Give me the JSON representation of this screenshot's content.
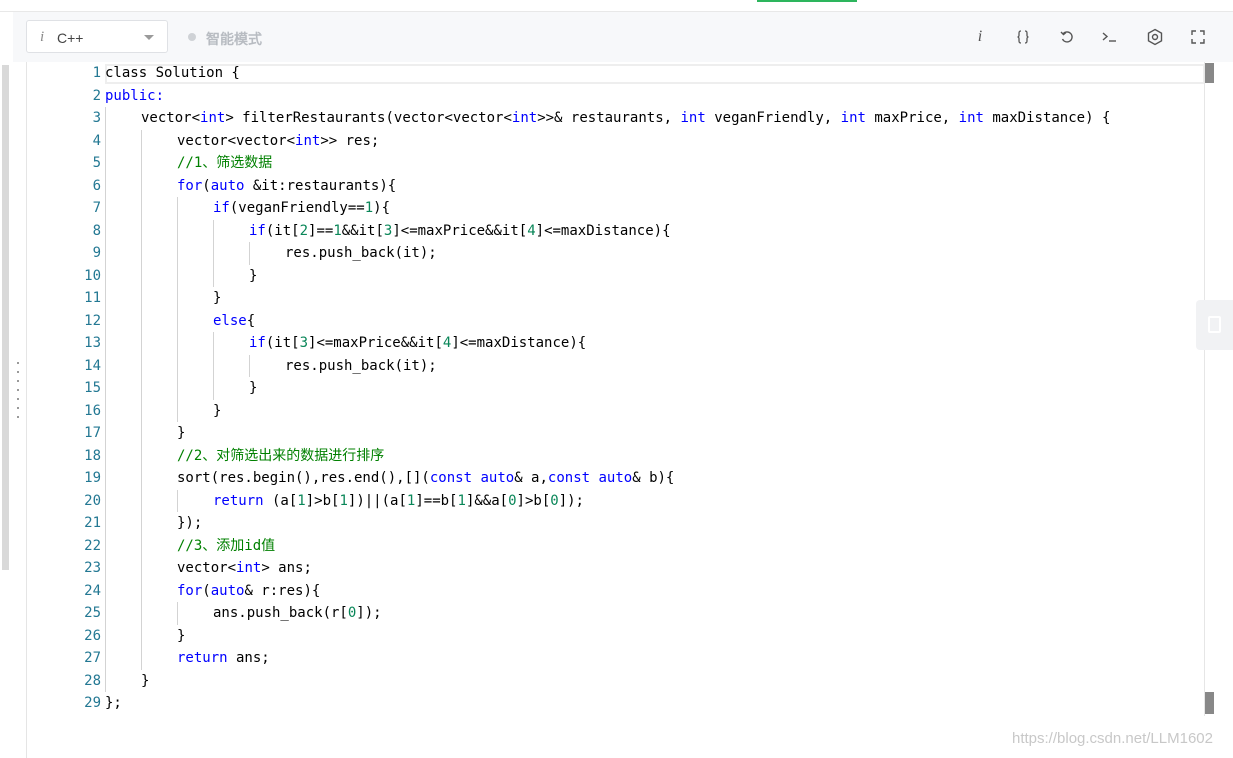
{
  "toolbar": {
    "info_glyph": "i",
    "language": "C++",
    "mode_label": "智能模式",
    "buttons": [
      {
        "name": "info-button",
        "icon": "info-icon"
      },
      {
        "name": "format-button",
        "icon": "braces-icon"
      },
      {
        "name": "reset-button",
        "icon": "undo-icon"
      },
      {
        "name": "console-button",
        "icon": "terminal-icon"
      },
      {
        "name": "settings-button",
        "icon": "settings-icon"
      },
      {
        "name": "fullscreen-button",
        "icon": "fullscreen-icon"
      }
    ]
  },
  "editor": {
    "line_number_color": "#237893",
    "keyword_color": "#0000ff",
    "number_color": "#098658",
    "comment_color": "#008000",
    "lines": [
      {
        "n": "1",
        "indent": 0,
        "tokens": [
          {
            "t": "class Solution {"
          }
        ]
      },
      {
        "n": "2",
        "indent": 0,
        "tokens": [
          {
            "t": "public:",
            "c": "kw"
          }
        ]
      },
      {
        "n": "3",
        "indent": 1,
        "tokens": [
          {
            "t": "vector<"
          },
          {
            "t": "int",
            "c": "kw"
          },
          {
            "t": "> filterRestaurants(vector<vector<"
          },
          {
            "t": "int",
            "c": "kw"
          },
          {
            "t": ">>& restaurants, "
          },
          {
            "t": "int",
            "c": "kw"
          },
          {
            "t": " veganFriendly, "
          },
          {
            "t": "int",
            "c": "kw"
          },
          {
            "t": " maxPrice, "
          },
          {
            "t": "int",
            "c": "kw"
          },
          {
            "t": " maxDistance) {"
          }
        ]
      },
      {
        "n": "4",
        "indent": 2,
        "tokens": [
          {
            "t": "vector<vector<"
          },
          {
            "t": "int",
            "c": "kw"
          },
          {
            "t": ">> res;"
          }
        ]
      },
      {
        "n": "5",
        "indent": 2,
        "tokens": [
          {
            "t": "//1、筛选数据",
            "c": "cm"
          }
        ]
      },
      {
        "n": "6",
        "indent": 2,
        "tokens": [
          {
            "t": "for",
            "c": "kw"
          },
          {
            "t": "("
          },
          {
            "t": "auto",
            "c": "kw"
          },
          {
            "t": " &it:restaurants){"
          }
        ]
      },
      {
        "n": "7",
        "indent": 3,
        "tokens": [
          {
            "t": "if",
            "c": "kw"
          },
          {
            "t": "(veganFriendly=="
          },
          {
            "t": "1",
            "c": "num"
          },
          {
            "t": "){"
          }
        ]
      },
      {
        "n": "8",
        "indent": 4,
        "tokens": [
          {
            "t": "if",
            "c": "kw"
          },
          {
            "t": "(it["
          },
          {
            "t": "2",
            "c": "num"
          },
          {
            "t": "]=="
          },
          {
            "t": "1",
            "c": "num"
          },
          {
            "t": "&&it["
          },
          {
            "t": "3",
            "c": "num"
          },
          {
            "t": "]<=maxPrice&&it["
          },
          {
            "t": "4",
            "c": "num"
          },
          {
            "t": "]<=maxDistance){"
          }
        ]
      },
      {
        "n": "9",
        "indent": 5,
        "tokens": [
          {
            "t": "res.push_back(it);"
          }
        ]
      },
      {
        "n": "10",
        "indent": 4,
        "tokens": [
          {
            "t": "}"
          }
        ]
      },
      {
        "n": "11",
        "indent": 3,
        "tokens": [
          {
            "t": "}"
          }
        ]
      },
      {
        "n": "12",
        "indent": 3,
        "tokens": [
          {
            "t": "else",
            "c": "kw"
          },
          {
            "t": "{"
          }
        ]
      },
      {
        "n": "13",
        "indent": 4,
        "tokens": [
          {
            "t": "if",
            "c": "kw"
          },
          {
            "t": "(it["
          },
          {
            "t": "3",
            "c": "num"
          },
          {
            "t": "]<=maxPrice&&it["
          },
          {
            "t": "4",
            "c": "num"
          },
          {
            "t": "]<=maxDistance){"
          }
        ]
      },
      {
        "n": "14",
        "indent": 5,
        "tokens": [
          {
            "t": "res.push_back(it);"
          }
        ]
      },
      {
        "n": "15",
        "indent": 4,
        "tokens": [
          {
            "t": "}"
          }
        ]
      },
      {
        "n": "16",
        "indent": 3,
        "tokens": [
          {
            "t": "}"
          }
        ]
      },
      {
        "n": "17",
        "indent": 2,
        "tokens": [
          {
            "t": "}"
          }
        ]
      },
      {
        "n": "18",
        "indent": 2,
        "tokens": [
          {
            "t": "//2、对筛选出来的数据进行排序",
            "c": "cm"
          }
        ]
      },
      {
        "n": "19",
        "indent": 2,
        "tokens": [
          {
            "t": "sort(res.begin(),res.end(),[]("
          },
          {
            "t": "const",
            "c": "kw"
          },
          {
            "t": " "
          },
          {
            "t": "auto",
            "c": "kw"
          },
          {
            "t": "& a,"
          },
          {
            "t": "const",
            "c": "kw"
          },
          {
            "t": " "
          },
          {
            "t": "auto",
            "c": "kw"
          },
          {
            "t": "& b){"
          }
        ]
      },
      {
        "n": "20",
        "indent": 3,
        "tokens": [
          {
            "t": "return",
            "c": "kw"
          },
          {
            "t": " (a["
          },
          {
            "t": "1",
            "c": "num"
          },
          {
            "t": "]>b["
          },
          {
            "t": "1",
            "c": "num"
          },
          {
            "t": "])||(a["
          },
          {
            "t": "1",
            "c": "num"
          },
          {
            "t": "]==b["
          },
          {
            "t": "1",
            "c": "num"
          },
          {
            "t": "]&&a["
          },
          {
            "t": "0",
            "c": "num"
          },
          {
            "t": "]>b["
          },
          {
            "t": "0",
            "c": "num"
          },
          {
            "t": "]);"
          }
        ]
      },
      {
        "n": "21",
        "indent": 2,
        "tokens": [
          {
            "t": "});"
          }
        ]
      },
      {
        "n": "22",
        "indent": 2,
        "tokens": [
          {
            "t": "//3、添加id值",
            "c": "cm"
          }
        ]
      },
      {
        "n": "23",
        "indent": 2,
        "tokens": [
          {
            "t": "vector<"
          },
          {
            "t": "int",
            "c": "kw"
          },
          {
            "t": "> ans;"
          }
        ]
      },
      {
        "n": "24",
        "indent": 2,
        "tokens": [
          {
            "t": "for",
            "c": "kw"
          },
          {
            "t": "("
          },
          {
            "t": "auto",
            "c": "kw"
          },
          {
            "t": "& r:res){"
          }
        ]
      },
      {
        "n": "25",
        "indent": 3,
        "tokens": [
          {
            "t": "ans.push_back(r["
          },
          {
            "t": "0",
            "c": "num"
          },
          {
            "t": "]);"
          }
        ]
      },
      {
        "n": "26",
        "indent": 2,
        "tokens": [
          {
            "t": "}"
          }
        ]
      },
      {
        "n": "27",
        "indent": 2,
        "tokens": [
          {
            "t": "return",
            "c": "kw"
          },
          {
            "t": " ans;"
          }
        ]
      },
      {
        "n": "28",
        "indent": 1,
        "tokens": [
          {
            "t": "}"
          }
        ]
      },
      {
        "n": "29",
        "indent": 0,
        "tokens": [
          {
            "t": "};"
          }
        ]
      }
    ]
  },
  "watermark": "https://blog.csdn.net/LLM1602"
}
